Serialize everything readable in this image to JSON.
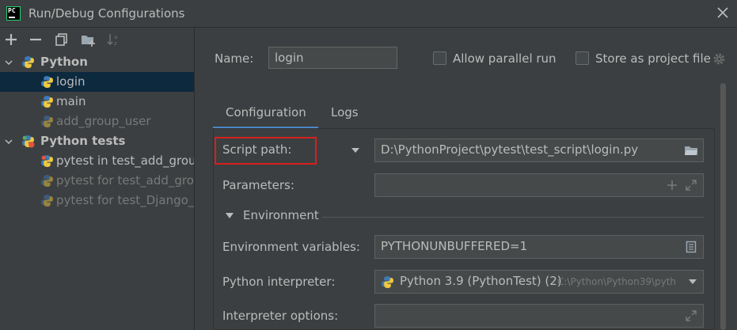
{
  "window": {
    "title": "Run/Debug Configurations",
    "app_icon_text": "PC"
  },
  "tree": {
    "groups": [
      {
        "label": "Python",
        "items": [
          {
            "label": "login",
            "selected": true,
            "dim": false
          },
          {
            "label": "main",
            "selected": false,
            "dim": false
          },
          {
            "label": "add_group_user",
            "selected": false,
            "dim": true
          }
        ]
      },
      {
        "label": "Python tests",
        "items": [
          {
            "label": "pytest in test_add_group",
            "dim": false
          },
          {
            "label": "pytest for test_add_grou",
            "dim": true
          },
          {
            "label": "pytest for test_Django_lo",
            "dim": true
          }
        ]
      }
    ]
  },
  "form": {
    "name_label": "Name:",
    "name_value": "login",
    "allow_parallel_label": "Allow parallel run",
    "store_project_label": "Store as project file",
    "tabs": [
      "Configuration",
      "Logs"
    ],
    "script_path_label": "Script path:",
    "script_path_value": "D:\\PythonProject\\pytest\\test_script\\login.py",
    "parameters_label": "Parameters:",
    "environment_section": "Environment",
    "env_vars_label": "Environment variables:",
    "env_vars_value": "PYTHONUNBUFFERED=1",
    "interpreter_label": "Python interpreter:",
    "interpreter_value": "Python 3.9 (PythonTest) (2)",
    "interpreter_hint": "C:\\Python\\Python39\\pyth",
    "interpreter_options_label": "Interpreter options:"
  },
  "colors": {
    "highlight": "#d81e1e",
    "selection": "#0d293e",
    "tab_underline": "#4a88c7"
  },
  "icons": [
    "add-icon",
    "remove-icon",
    "copy-icon",
    "folder-add-icon",
    "sort-icon",
    "gear-icon",
    "folder-icon",
    "expand-icon",
    "document-icon",
    "python-icon",
    "pytest-icon"
  ]
}
